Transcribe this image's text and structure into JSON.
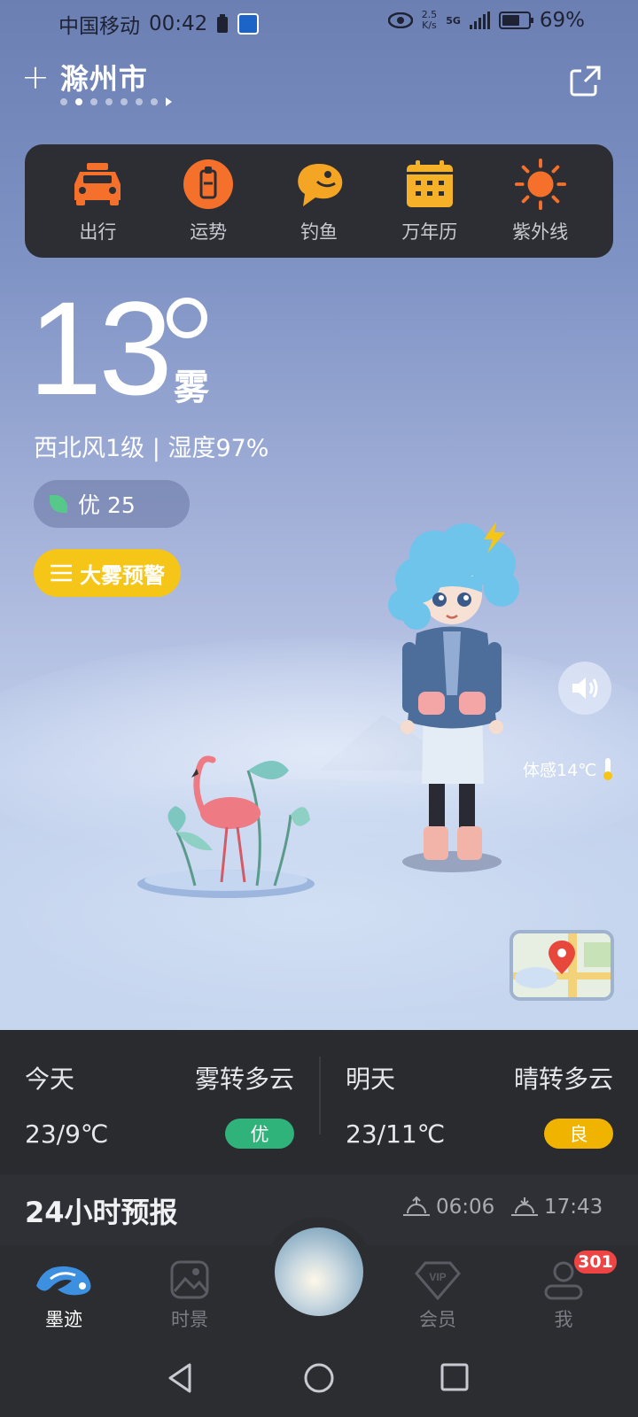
{
  "status_bar": {
    "carrier": "中国移动",
    "time": "00:42",
    "net_speed_value": "2.5",
    "net_speed_unit": "K/s",
    "network": "5G",
    "battery": "69%",
    "battery_level": 0.69
  },
  "header": {
    "add_symbol": "+",
    "city": "滁州市",
    "page_count": 7,
    "active_page": 1
  },
  "quick_actions": [
    {
      "label": "出行",
      "icon": "taxi-icon"
    },
    {
      "label": "运势",
      "icon": "fortune-icon"
    },
    {
      "label": "钓鱼",
      "icon": "fish-icon"
    },
    {
      "label": "万年历",
      "icon": "calendar-icon"
    },
    {
      "label": "紫外线",
      "icon": "sun-icon"
    }
  ],
  "current": {
    "temperature": "13",
    "condition": "雾",
    "wind_humidity": "西北风1级 | 湿度97%",
    "aqi_text": "优 25",
    "warning": "大雾预警",
    "feels_like": "体感14℃"
  },
  "forecast": [
    {
      "day": "今天",
      "condition": "雾转多云",
      "temps": "23/9℃",
      "aqi": "优",
      "aqi_color": "#2fb37a"
    },
    {
      "day": "明天",
      "condition": "晴转多云",
      "temps": "23/11℃",
      "aqi": "良",
      "aqi_color": "#f0b400"
    }
  ],
  "hourly": {
    "title": "24小时预报",
    "sunrise": "06:06",
    "sunset": "17:43"
  },
  "tabs": [
    {
      "label": "墨迹",
      "active": true
    },
    {
      "label": "时景",
      "active": false
    },
    {
      "label": "会员",
      "active": false
    },
    {
      "label": "我",
      "active": false
    }
  ],
  "notifications": "301",
  "colors": {
    "accent_orange": "#f5702b",
    "warning_yellow": "#f5c518",
    "aqi_good": "#2fb37a",
    "aqi_moderate": "#f0b400",
    "badge_red": "#ef4444"
  }
}
